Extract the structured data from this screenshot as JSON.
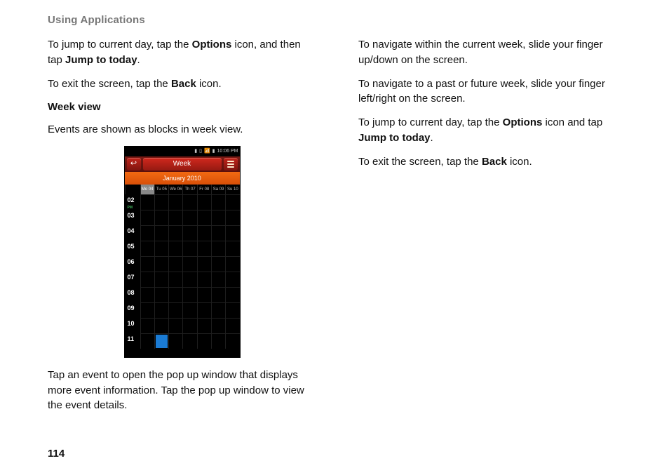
{
  "header": "Using Applications",
  "page_number": "114",
  "left": {
    "p1_a": "To jump to current day, tap the ",
    "p1_b": "Options",
    "p1_c": " icon, and then tap ",
    "p1_d": "Jump to today",
    "p1_e": ".",
    "p2_a": "To exit the screen, tap the ",
    "p2_b": "Back",
    "p2_c": " icon.",
    "subhead": "Week view",
    "p3": "Events are shown as blocks in week view.",
    "p4": "Tap an event to open the pop up window that displays more event information. Tap the pop up window to view the event details."
  },
  "right": {
    "p1": "To navigate within the current week, slide your finger up/down on the screen.",
    "p2": "To navigate to a past or future week, slide your finger left/right on the screen.",
    "p3_a": "To jump to current day, tap the ",
    "p3_b": "Options",
    "p3_c": " icon and tap ",
    "p3_d": "Jump to today",
    "p3_e": ".",
    "p4_a": "To exit the screen, tap the ",
    "p4_b": "Back",
    "p4_c": " icon."
  },
  "phone": {
    "status_time": "10:06 PM",
    "title": "Week",
    "month": "January 2010",
    "days": [
      "Mo 04",
      "Tu 05",
      "We 06",
      "Th 07",
      "Fr 08",
      "Sa 09",
      "Su 10"
    ],
    "hours": [
      "02",
      "03",
      "04",
      "05",
      "06",
      "07",
      "08",
      "09",
      "10",
      "11"
    ]
  }
}
